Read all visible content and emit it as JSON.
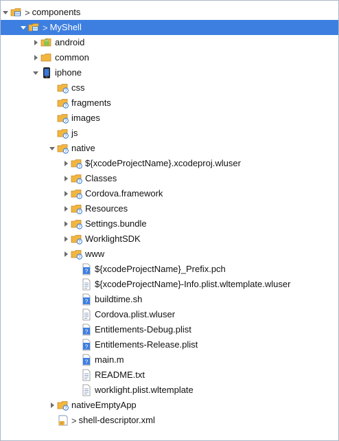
{
  "tree": {
    "items": [
      {
        "label": "components",
        "prefix": ">",
        "icon": "project-folder-icon",
        "toggle": "expanded",
        "depth": 0,
        "selected": false
      },
      {
        "label": "MyShell",
        "prefix": ">",
        "icon": "project-folder-icon",
        "toggle": "expanded",
        "depth": 1,
        "selected": true
      },
      {
        "label": "android",
        "prefix": "",
        "icon": "android-icon",
        "toggle": "collapsed",
        "depth": 2,
        "selected": false
      },
      {
        "label": "common",
        "prefix": "",
        "icon": "folder-icon",
        "toggle": "collapsed",
        "depth": 2,
        "selected": false
      },
      {
        "label": "iphone",
        "prefix": "",
        "icon": "iphone-icon",
        "toggle": "expanded",
        "depth": 2,
        "selected": false
      },
      {
        "label": "css",
        "prefix": "",
        "icon": "folder-unknown-icon",
        "toggle": "none",
        "depth": 3,
        "selected": false
      },
      {
        "label": "fragments",
        "prefix": "",
        "icon": "folder-unknown-icon",
        "toggle": "none",
        "depth": 3,
        "selected": false
      },
      {
        "label": "images",
        "prefix": "",
        "icon": "folder-unknown-icon",
        "toggle": "none",
        "depth": 3,
        "selected": false
      },
      {
        "label": "js",
        "prefix": "",
        "icon": "folder-unknown-icon",
        "toggle": "none",
        "depth": 3,
        "selected": false
      },
      {
        "label": "native",
        "prefix": "",
        "icon": "folder-unknown-icon",
        "toggle": "expanded",
        "depth": 3,
        "selected": false
      },
      {
        "label": "${xcodeProjectName}.xcodeproj.wluser",
        "prefix": "",
        "icon": "folder-unknown-icon",
        "toggle": "collapsed",
        "depth": 4,
        "selected": false
      },
      {
        "label": "Classes",
        "prefix": "",
        "icon": "folder-unknown-icon",
        "toggle": "collapsed",
        "depth": 4,
        "selected": false
      },
      {
        "label": "Cordova.framework",
        "prefix": "",
        "icon": "folder-unknown-icon",
        "toggle": "collapsed",
        "depth": 4,
        "selected": false
      },
      {
        "label": "Resources",
        "prefix": "",
        "icon": "folder-unknown-icon",
        "toggle": "collapsed",
        "depth": 4,
        "selected": false
      },
      {
        "label": "Settings.bundle",
        "prefix": "",
        "icon": "folder-unknown-icon",
        "toggle": "collapsed",
        "depth": 4,
        "selected": false
      },
      {
        "label": "WorklightSDK",
        "prefix": "",
        "icon": "folder-unknown-icon",
        "toggle": "collapsed",
        "depth": 4,
        "selected": false
      },
      {
        "label": "www",
        "prefix": "",
        "icon": "folder-unknown-icon",
        "toggle": "collapsed",
        "depth": 4,
        "selected": false
      },
      {
        "label": "${xcodeProjectName}_Prefix.pch",
        "prefix": "",
        "icon": "file-unknown-icon",
        "toggle": "none",
        "depth": 5,
        "selected": false
      },
      {
        "label": "${xcodeProjectName}-Info.plist.wltemplate.wluser",
        "prefix": "",
        "icon": "text-file-icon",
        "toggle": "none",
        "depth": 5,
        "selected": false
      },
      {
        "label": "buildtime.sh",
        "prefix": "",
        "icon": "file-unknown-icon",
        "toggle": "none",
        "depth": 5,
        "selected": false
      },
      {
        "label": "Cordova.plist.wluser",
        "prefix": "",
        "icon": "text-file-icon",
        "toggle": "none",
        "depth": 5,
        "selected": false
      },
      {
        "label": "Entitlements-Debug.plist",
        "prefix": "",
        "icon": "file-unknown-icon",
        "toggle": "none",
        "depth": 5,
        "selected": false
      },
      {
        "label": "Entitlements-Release.plist",
        "prefix": "",
        "icon": "file-unknown-icon",
        "toggle": "none",
        "depth": 5,
        "selected": false
      },
      {
        "label": "main.m",
        "prefix": "",
        "icon": "file-unknown-icon",
        "toggle": "none",
        "depth": 5,
        "selected": false
      },
      {
        "label": "README.txt",
        "prefix": "",
        "icon": "text-file-icon",
        "toggle": "none",
        "depth": 5,
        "selected": false
      },
      {
        "label": "worklight.plist.wltemplate",
        "prefix": "",
        "icon": "text-file-icon",
        "toggle": "none",
        "depth": 5,
        "selected": false
      },
      {
        "label": "nativeEmptyApp",
        "prefix": "",
        "icon": "folder-unknown-icon",
        "toggle": "collapsed",
        "depth": 3,
        "selected": false
      },
      {
        "label": "shell-descriptor.xml",
        "prefix": ">",
        "icon": "xml-file-icon",
        "toggle": "none",
        "depth": 3,
        "selected": false
      }
    ]
  },
  "colors": {
    "selection": "#3d7fe0",
    "folder": "#f2b640",
    "android": "#8bc34a",
    "unknown_badge": "#2b74d1"
  }
}
